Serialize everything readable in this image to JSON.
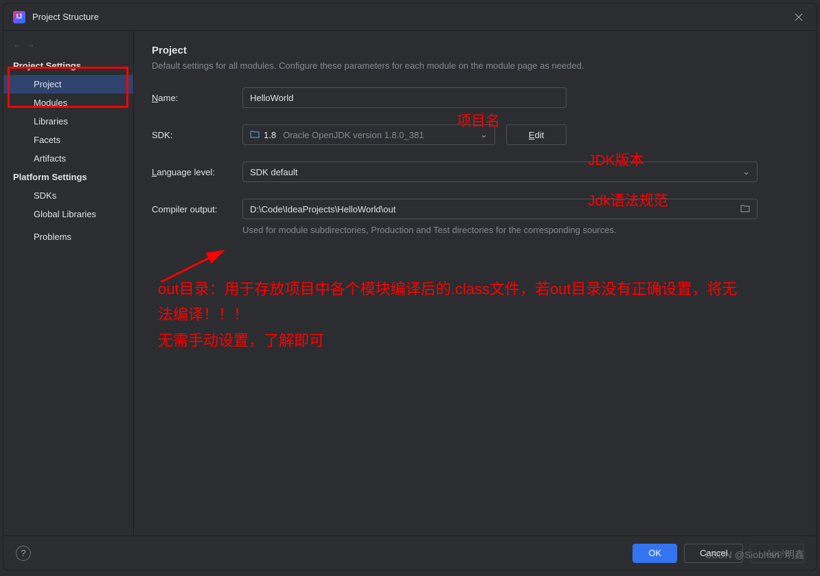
{
  "window": {
    "title": "Project Structure",
    "app_icon_letter": "IJ"
  },
  "sidebar": {
    "section1": "Project Settings",
    "section2": "Platform Settings",
    "items1": [
      "Project",
      "Modules",
      "Libraries",
      "Facets",
      "Artifacts"
    ],
    "items2": [
      "SDKs",
      "Global Libraries"
    ],
    "problems": "Problems"
  },
  "main": {
    "heading": "Project",
    "subtitle": "Default settings for all modules. Configure these parameters for each module on the module page as needed.",
    "name_label": "Name:",
    "name_value": "HelloWorld",
    "sdk_label_pre": "SDK:",
    "sdk_version": "1.8",
    "sdk_detail": "Oracle OpenJDK version 1.8.0_381",
    "edit_label": "Edit",
    "lang_label_pre": "L",
    "lang_label_post": "anguage level:",
    "lang_value": "SDK default",
    "out_label": "Compiler output:",
    "out_value": "D:\\Code\\IdeaProjects\\HelloWorld\\out",
    "out_hint": "Used for module subdirectories, Production and Test directories for the corresponding sources."
  },
  "annotations": {
    "a1": "项目名",
    "a2": "JDK版本",
    "a3": "Jdk语法规范",
    "a4_line1": "out目录：用于存放项目中各个模块编译后的.class文件，若out目录没有正确设置，将无法编译！！！",
    "a4_line2": "无需手动设置，了解即可"
  },
  "footer": {
    "ok": "OK",
    "cancel": "Cancel",
    "apply": "Apply"
  },
  "watermark": "CSDN @Siobhan. 明鑫"
}
